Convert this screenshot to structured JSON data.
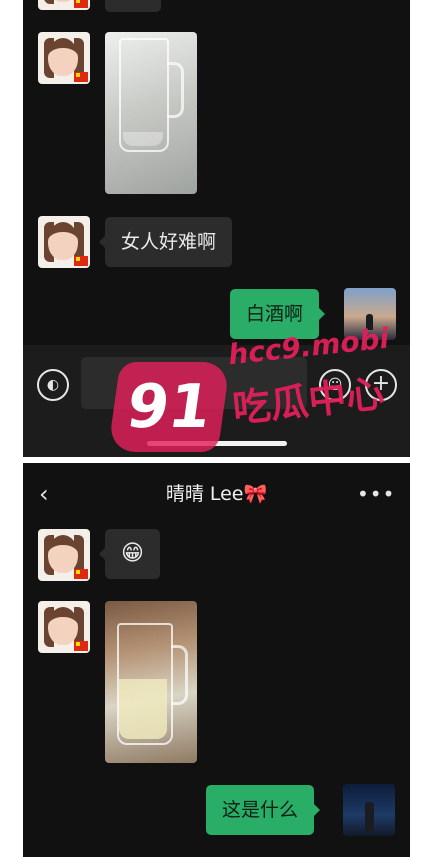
{
  "top_chat": {
    "messages": [
      {
        "from": "contact",
        "type": "image"
      },
      {
        "from": "contact",
        "type": "text",
        "text": "女人好难啊"
      },
      {
        "from": "me",
        "type": "text",
        "text": "白酒啊"
      }
    ],
    "composer": {
      "voice_icon": "voice-icon",
      "emoji_icon": "emoji-icon",
      "plus_icon": "plus-icon",
      "voice_glyph": "◐",
      "emoji_glyph": "☺",
      "plus_glyph": "+"
    }
  },
  "bottom_chat": {
    "header": {
      "back_glyph": "‹",
      "title": "晴晴 Lee🎀",
      "more_glyph": "•••"
    },
    "messages": [
      {
        "from": "contact",
        "type": "text",
        "text": "😁"
      },
      {
        "from": "contact",
        "type": "image"
      },
      {
        "from": "me",
        "type": "text",
        "text": "这是什么"
      }
    ]
  },
  "watermark": {
    "badge": "91",
    "url": "hcc9.mobi",
    "label": "吃瓜中心"
  },
  "colors": {
    "chat_bg": "#111111",
    "incoming_bubble": "#2c2c2c",
    "outgoing_bubble": "#2aae67",
    "watermark": "#e2205a"
  }
}
